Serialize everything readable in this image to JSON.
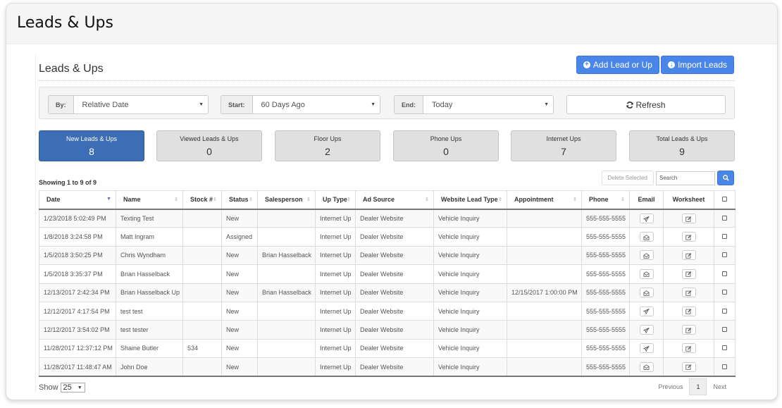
{
  "page": {
    "title": "Leads & Ups"
  },
  "section": {
    "title": "Leads & Ups",
    "add_button": "Add Lead or Up",
    "import_button": "Import Leads"
  },
  "filters": {
    "by": {
      "label": "By:",
      "value": "Relative Date"
    },
    "start": {
      "label": "Start:",
      "value": "60 Days Ago"
    },
    "end": {
      "label": "End:",
      "value": "Today"
    },
    "refresh_label": "Refresh"
  },
  "tiles": [
    {
      "label": "New Leads & Ups",
      "count": "8",
      "active": true
    },
    {
      "label": "Viewed Leads & Ups",
      "count": "0",
      "active": false
    },
    {
      "label": "Floor Ups",
      "count": "2",
      "active": false
    },
    {
      "label": "Phone Ups",
      "count": "0",
      "active": false
    },
    {
      "label": "Internet Ups",
      "count": "7",
      "active": false
    },
    {
      "label": "Total Leads & Ups",
      "count": "9",
      "active": false
    }
  ],
  "table": {
    "showing": "Showing 1 to 9 of 9",
    "delete_selected": "Delete Selected",
    "search_placeholder": "Search",
    "columns": [
      "Date",
      "Name",
      "Stock #",
      "Status",
      "Salesperson",
      "Up Type",
      "Ad Source",
      "Website Lead Type",
      "Appointment",
      "Phone",
      "Email",
      "Worksheet"
    ],
    "rows": [
      {
        "date": "1/23/2018 5:02:49 PM",
        "name": "Texting Test",
        "stock": "",
        "status": "New",
        "salesperson": "",
        "up_type": "Internet Up",
        "ad_source": "Dealer Website",
        "lead_type": "Vehicle Inquiry",
        "appointment": "",
        "phone": "555-555-5555",
        "email_icon": "send-icon"
      },
      {
        "date": "1/8/2018 3:24:58 PM",
        "name": "Matt Ingram",
        "stock": "",
        "status": "Assigned",
        "salesperson": "",
        "up_type": "Internet Up",
        "ad_source": "Dealer Website",
        "lead_type": "Vehicle Inquiry",
        "appointment": "",
        "phone": "555-555-5555",
        "email_icon": "envelope-open-icon"
      },
      {
        "date": "1/5/2018 3:50:25 PM",
        "name": "Chris Wyndham",
        "stock": "",
        "status": "New",
        "salesperson": "Brian Hasselback",
        "up_type": "Internet Up",
        "ad_source": "Dealer Website",
        "lead_type": "Vehicle Inquiry",
        "appointment": "",
        "phone": "555-555-5555",
        "email_icon": "envelope-open-icon"
      },
      {
        "date": "1/5/2018 3:35:37 PM",
        "name": "Brian Hasselback",
        "stock": "",
        "status": "New",
        "salesperson": "",
        "up_type": "Internet Up",
        "ad_source": "Dealer Website",
        "lead_type": "Vehicle Inquiry",
        "appointment": "",
        "phone": "555-555-5555",
        "email_icon": "envelope-open-icon"
      },
      {
        "date": "12/13/2017 2:42:34 PM",
        "name": "Brian Hasselback Up",
        "stock": "",
        "status": "New",
        "salesperson": "Brian Hasselback",
        "up_type": "Internet Up",
        "ad_source": "Dealer Website",
        "lead_type": "Vehicle Inquiry",
        "appointment": "12/15/2017 1:00:00 PM",
        "phone": "555-555-5555",
        "email_icon": "envelope-open-icon"
      },
      {
        "date": "12/12/2017 4:17:54 PM",
        "name": "test test",
        "stock": "",
        "status": "New",
        "salesperson": "",
        "up_type": "Internet Up",
        "ad_source": "Dealer Website",
        "lead_type": "Vehicle Inquiry",
        "appointment": "",
        "phone": "555-555-5555",
        "email_icon": "send-icon"
      },
      {
        "date": "12/12/2017 3:54:02 PM",
        "name": "test tester",
        "stock": "",
        "status": "New",
        "salesperson": "",
        "up_type": "Internet Up",
        "ad_source": "Dealer Website",
        "lead_type": "Vehicle Inquiry",
        "appointment": "",
        "phone": "555-555-5555",
        "email_icon": "send-icon"
      },
      {
        "date": "11/28/2017 12:37:12 PM",
        "name": "Shaine Butler",
        "stock": "534",
        "status": "New",
        "salesperson": "",
        "up_type": "Internet Up",
        "ad_source": "Dealer Website",
        "lead_type": "Vehicle Inquiry",
        "appointment": "",
        "phone": "555-555-5555",
        "email_icon": "send-icon"
      },
      {
        "date": "11/28/2017 11:48:47 AM",
        "name": "John Doe",
        "stock": "",
        "status": "New",
        "salesperson": "",
        "up_type": "Internet Up",
        "ad_source": "Dealer Website",
        "lead_type": "Vehicle Inquiry",
        "appointment": "",
        "phone": "555-555-5555",
        "email_icon": "envelope-open-icon"
      }
    ]
  },
  "footer": {
    "show_label": "Show",
    "page_length": "25",
    "previous": "Previous",
    "current_page": "1",
    "next": "Next"
  },
  "colors": {
    "primary": "#4a86e8",
    "active_tile": "#3d6db5"
  }
}
